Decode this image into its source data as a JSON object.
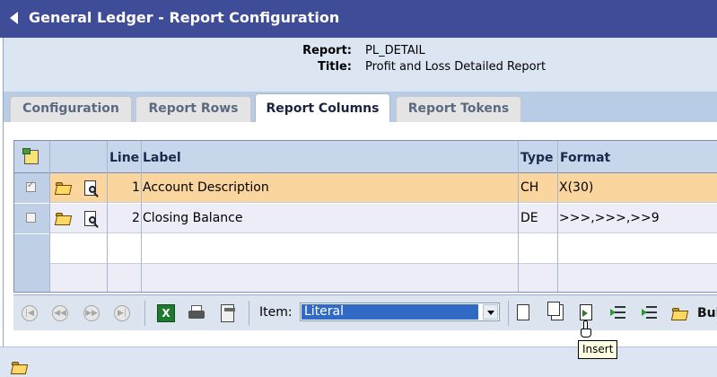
{
  "window": {
    "title": "General Ledger - Report Configuration"
  },
  "header": {
    "report_label": "Report:",
    "report_value": "PL_DETAIL",
    "title_label": "Title:",
    "title_value": "Profit and Loss Detailed Report"
  },
  "tabs": [
    {
      "label": "Configuration",
      "active": false
    },
    {
      "label": "Report Rows",
      "active": false
    },
    {
      "label": "Report Columns",
      "active": true
    },
    {
      "label": "Report Tokens",
      "active": false
    }
  ],
  "grid": {
    "columns": {
      "line": "Line",
      "label": "Label",
      "type": "Type",
      "format": "Format"
    },
    "rows": [
      {
        "checked": true,
        "line": "1",
        "label": "Account Description",
        "type": "CH",
        "format": "X(30)"
      },
      {
        "checked": false,
        "line": "2",
        "label": "Closing Balance",
        "type": "DE",
        "format": ">>>,>>>,>>9"
      }
    ]
  },
  "toolbar": {
    "item_label": "Item:",
    "item_value": "Literal",
    "partial_button": "Bul"
  },
  "tooltip": {
    "text": "Insert"
  },
  "colors": {
    "titlebar": "#3f4c98",
    "selected_row": "#fbd59e",
    "header_panel": "#dce6f3"
  }
}
